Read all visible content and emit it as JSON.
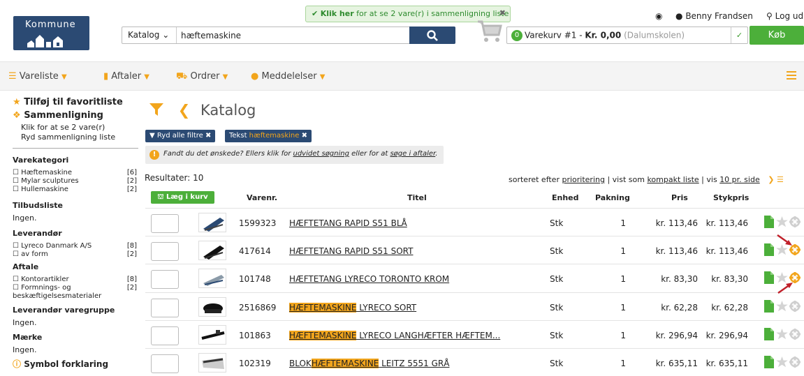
{
  "header": {
    "logo_text": "Kommune",
    "notice_bold": "Klik her",
    "notice_text": " for at se 2 vare(r) i sammenligning liste",
    "user_name": "Benny Frandsen",
    "logout_label": "Log ud",
    "search_scope": "Katalog",
    "search_value": "hæftemaskine",
    "basket_count": "0",
    "basket_name": "Varekurv #1 - ",
    "basket_amount": "Kr. 0,00",
    "basket_location": "(Dalumskolen)",
    "buy_label": "Køb"
  },
  "nav": {
    "items": [
      {
        "label": "Vareliste"
      },
      {
        "label": "Aftaler"
      },
      {
        "label": "Ordrer"
      },
      {
        "label": "Meddelelser"
      }
    ]
  },
  "sidebar": {
    "favorite_label": "Tilføj til favoritliste",
    "compare_label": "Sammenligning",
    "compare_line1": "Klik for at se 2 vare(r)",
    "compare_line2": "Ryd sammenligning liste",
    "category_heading": "Varekategori",
    "categories": [
      {
        "label": "Hæftemaskine",
        "count": "[6]"
      },
      {
        "label": "Mylar sculptures",
        "count": "[2]"
      },
      {
        "label": "Hullemaskine",
        "count": "[2]"
      }
    ],
    "offer_heading": "Tilbudsliste",
    "offer_value": "Ingen.",
    "supplier_heading": "Leverandør",
    "suppliers": [
      {
        "label": "Lyreco Danmark A/S",
        "count": "[8]"
      },
      {
        "label": "av form",
        "count": "[2]"
      }
    ],
    "agreement_heading": "Aftale",
    "agreements": [
      {
        "label": "Kontorartikler",
        "count": "[8]"
      },
      {
        "label": "Formnings- og",
        "count": "[2]"
      }
    ],
    "agreement_cont": "beskæftigelsesmaterialer",
    "group_heading": "Leverandør varegruppe",
    "group_value": "Ingen.",
    "brand_heading": "Mærke",
    "brand_value": "Ingen.",
    "legend_label": "Symbol forklaring"
  },
  "main": {
    "title": "Katalog",
    "chip_clear": "Ryd alle filtre",
    "chip_text_label": "Tekst",
    "chip_text_value": "hæftemaskine",
    "hint_text": "Fandt du det ønskede? Ellers klik for ",
    "hint_link1": "udvidet søgning",
    "hint_mid": " eller for at ",
    "hint_link2": "søge i aftaler",
    "hint_end": ".",
    "results": "Resultater: 10",
    "sort_prefix": "sorteret efter ",
    "sort_link": "prioritering",
    "view_prefix": "  | vist som ",
    "view_link": "kompakt liste",
    "per_prefix": " | vis ",
    "per_link": "10 pr. side",
    "add_to_cart": "Læg i kurv",
    "columns": {
      "varenr": "Varenr.",
      "titel": "Titel",
      "enhed": "Enhed",
      "pakning": "Pakning",
      "pris": "Pris",
      "stykpris": "Stykpris"
    }
  },
  "products": [
    {
      "varenr": "1599323",
      "title_pre": "",
      "title_hl": "",
      "title_post": "HÆFTETANG RAPID S51 BLÅ",
      "unit": "Stk",
      "pak": "1",
      "price": "kr. 113,46",
      "sprice": "kr. 113,46",
      "compare_active": false
    },
    {
      "varenr": "417614",
      "title_pre": "",
      "title_hl": "",
      "title_post": "HÆFTETANG RAPID S51 SORT",
      "unit": "Stk",
      "pak": "1",
      "price": "kr. 113,46",
      "sprice": "kr. 113,46",
      "compare_active": true
    },
    {
      "varenr": "101748",
      "title_pre": "",
      "title_hl": "",
      "title_post": "HÆFTETANG LYRECO TORONTO KROM",
      "unit": "Stk",
      "pak": "1",
      "price": "kr. 83,30",
      "sprice": "kr. 83,30",
      "compare_active": true
    },
    {
      "varenr": "2516869",
      "title_pre": "",
      "title_hl": "HÆFTEMASKINE",
      "title_post": " LYRECO SORT",
      "unit": "Stk",
      "pak": "1",
      "price": "kr. 62,28",
      "sprice": "kr. 62,28",
      "compare_active": false
    },
    {
      "varenr": "101863",
      "title_pre": "",
      "title_hl": "HÆFTEMASKINE",
      "title_post": " LYRECO LANGHÆFTER HÆFTEM...",
      "unit": "Stk",
      "pak": "1",
      "price": "kr. 296,94",
      "sprice": "kr. 296,94",
      "compare_active": false
    },
    {
      "varenr": "102319",
      "title_pre": "BLOK",
      "title_hl": "HÆFTEMASKINE",
      "title_post": " LEITZ 5551 GRÅ",
      "unit": "Stk",
      "pak": "1",
      "price": "kr. 635,11",
      "sprice": "kr. 635,11",
      "compare_active": false
    }
  ],
  "colors": {
    "brand": "#2b4a73",
    "accent": "#f2a51c",
    "green": "#4caf3a",
    "arrow": "#c0202a"
  }
}
